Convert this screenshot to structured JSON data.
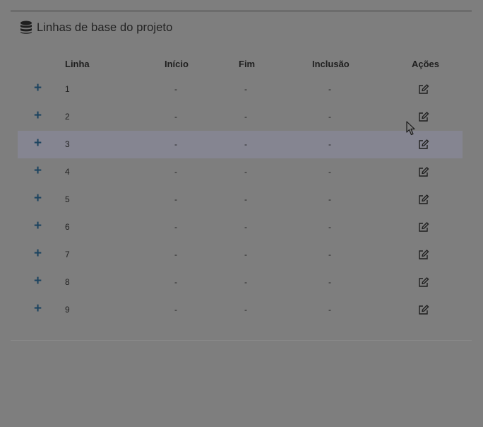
{
  "panel": {
    "title": "Linhas de base do projeto",
    "icon": "database-icon"
  },
  "table": {
    "headers": {
      "linha": "Linha",
      "inicio": "Início",
      "fim": "Fim",
      "inclusao": "Inclusão",
      "acoes": "Ações"
    },
    "rows": [
      {
        "linha": "1",
        "inicio": "-",
        "fim": "-",
        "inclusao": "-"
      },
      {
        "linha": "2",
        "inicio": "-",
        "fim": "-",
        "inclusao": "-"
      },
      {
        "linha": "3",
        "inicio": "-",
        "fim": "-",
        "inclusao": "-"
      },
      {
        "linha": "4",
        "inicio": "-",
        "fim": "-",
        "inclusao": "-"
      },
      {
        "linha": "5",
        "inicio": "-",
        "fim": "-",
        "inclusao": "-"
      },
      {
        "linha": "6",
        "inicio": "-",
        "fim": "-",
        "inclusao": "-"
      },
      {
        "linha": "7",
        "inicio": "-",
        "fim": "-",
        "inclusao": "-"
      },
      {
        "linha": "8",
        "inicio": "-",
        "fim": "-",
        "inclusao": "-"
      },
      {
        "linha": "9",
        "inicio": "-",
        "fim": "-",
        "inclusao": "-"
      }
    ],
    "expand_glyph": "+",
    "highlighted_row": 2
  },
  "colors": {
    "overlay": "#7e7e7e",
    "expand_icon": "#1d4460",
    "highlight": "#858591"
  }
}
